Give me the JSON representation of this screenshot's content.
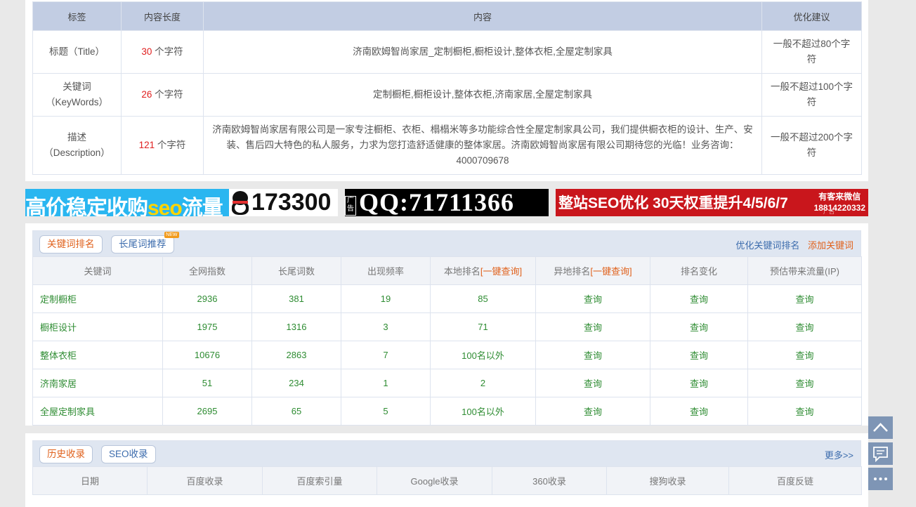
{
  "meta": {
    "headers": [
      "标签",
      "内容长度",
      "内容",
      "优化建议"
    ],
    "unit": "个字符",
    "rows": [
      {
        "label": "标题（Title）",
        "length": "30",
        "content": "济南欧姆智尚家居_定制橱柜,橱柜设计,整体衣柜,全屋定制家具",
        "advice": "一般不超过80个字符"
      },
      {
        "label_line1": "关键词",
        "label_line2": "（KeyWords）",
        "length": "26",
        "content": "定制橱柜,橱柜设计,整体衣柜,济南家居,全屋定制家具",
        "advice": "一般不超过100个字符"
      },
      {
        "label_line1": "描述",
        "label_line2": "（Description）",
        "length": "121",
        "content": "济南欧姆智尚家居有限公司是一家专注橱柜、衣柜、榻榻米等多功能综合性全屋定制家具公司，我们提供橱衣柜的设计、生产、安装、售后四大特色的私人服务，力求为您打造舒适健康的整体家居。济南欧姆智尚家居有限公司期待您的光临！业务咨询：4000709678",
        "advice": "一般不超过200个字符"
      }
    ]
  },
  "ads": {
    "ad1_text_a": "高价稳定收购",
    "ad1_text_seo": "seo",
    "ad1_text_b": "流量",
    "ad1_number": "173300",
    "ad2_tag": "广告",
    "ad2_text": "QQ:71711366",
    "ad3_text": "整站SEO优化 30天权重提升4/5/6/7",
    "ad3_side_line1": "有客来微信",
    "ad3_side_line2": "18814220332",
    "ad3_mini": "广告"
  },
  "keywords": {
    "tab_rank": "关键词排名",
    "tab_longtail": "长尾词推荐",
    "new_badge": "NEW",
    "link_optimize": "优化关键词排名",
    "link_add": "添加关键词",
    "headers": [
      "关键词",
      "全网指数",
      "长尾词数",
      "出现频率",
      "本地排名",
      "异地排名",
      "排名变化",
      "预估带来流量(IP)"
    ],
    "query_link": "[一键查询]",
    "rows": [
      {
        "kw": "定制橱柜",
        "index": "2936",
        "longtail": "381",
        "freq": "19",
        "local": "85",
        "remote": "查询",
        "change": "查询",
        "traffic": "查询"
      },
      {
        "kw": "橱柜设计",
        "index": "1975",
        "longtail": "1316",
        "freq": "3",
        "local": "71",
        "remote": "查询",
        "change": "查询",
        "traffic": "查询"
      },
      {
        "kw": "整体衣柜",
        "index": "10676",
        "longtail": "2863",
        "freq": "7",
        "local": "100名以外",
        "remote": "查询",
        "change": "查询",
        "traffic": "查询"
      },
      {
        "kw": "济南家居",
        "index": "51",
        "longtail": "234",
        "freq": "1",
        "local": "2",
        "remote": "查询",
        "change": "查询",
        "traffic": "查询"
      },
      {
        "kw": "全屋定制家具",
        "index": "2695",
        "longtail": "65",
        "freq": "5",
        "local": "100名以外",
        "remote": "查询",
        "change": "查询",
        "traffic": "查询"
      }
    ]
  },
  "history": {
    "tab_history": "历史收录",
    "tab_seo": "SEO收录",
    "more": "更多>>",
    "headers": [
      "日期",
      "百度收录",
      "百度索引量",
      "Google收录",
      "360收录",
      "搜狗收录",
      "百度反链"
    ]
  },
  "float_icons": [
    "arrow-up-icon",
    "chat-icon",
    "more-dots-icon"
  ],
  "colors": {
    "header_blue": "#c2cde3",
    "accent_orange": "#e0611c",
    "value_green": "#2e8c32",
    "red": "#e02020",
    "link_blue": "#3c6cad"
  }
}
